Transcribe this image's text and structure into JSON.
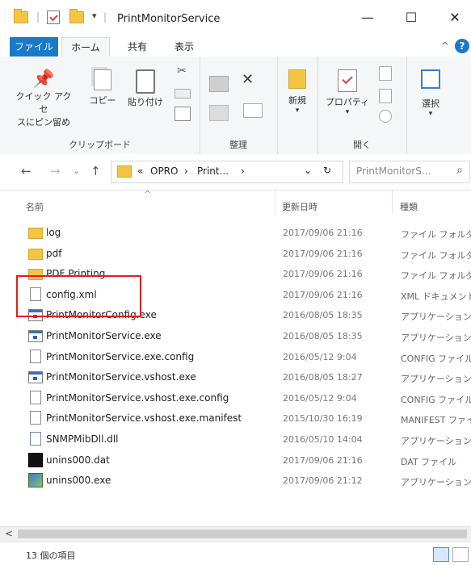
{
  "window": {
    "title": "PrintMonitorService",
    "controls": [
      "minimize-icon",
      "maximize-icon",
      "close-icon"
    ],
    "minimize_glyph": "—",
    "maximize_glyph": "☐",
    "close_glyph": "✕"
  },
  "ribbon_tabs": [
    "ファイル",
    "ホーム",
    "共有",
    "表示"
  ],
  "help_glyph": "?",
  "collapse_glyph": "^",
  "ribbon": {
    "clipboard": {
      "label": "クリップボード",
      "quick_access_line1": "クイック アクセ",
      "quick_access_line2": "スにピン留め",
      "copy": "コピー",
      "paste": "貼り付け"
    },
    "organize": {
      "label": "整理"
    },
    "open": {
      "label": "開く",
      "new": "新規",
      "properties": "プロパティ"
    },
    "select": {
      "label": "選択"
    }
  },
  "address": {
    "back": "←",
    "forward": "→",
    "down": "⌄",
    "up": "↑",
    "prefix": "«",
    "crumbs": [
      "OPRO",
      "Print..."
    ],
    "separator": "›",
    "dropdown": "⌄",
    "refresh": "↻",
    "search_placeholder": "PrintMonitorS...",
    "search_glyph": "⌕"
  },
  "columns": {
    "name": "名前",
    "date": "更新日時",
    "type": "種類",
    "sort_glyph": "^"
  },
  "files": [
    {
      "name": "log",
      "date": "2017/09/06 21:16",
      "type": "ファイル フォルダー",
      "icon": "folder-icon"
    },
    {
      "name": "pdf",
      "date": "2017/09/06 21:16",
      "type": "ファイル フォルダー",
      "icon": "folder-icon"
    },
    {
      "name": "PDF Printing",
      "date": "2017/09/06 21:16",
      "type": "ファイル フォルダー",
      "icon": "folder-icon"
    },
    {
      "name": "config.xml",
      "date": "2017/09/06 21:16",
      "type": "XML ドキュメント",
      "icon": "document-icon"
    },
    {
      "name": "PrintMonitorConfig.exe",
      "date": "2016/08/05 18:35",
      "type": "アプリケーション",
      "icon": "exe-icon"
    },
    {
      "name": "PrintMonitorService.exe",
      "date": "2016/08/05 18:35",
      "type": "アプリケーション",
      "icon": "exe-icon"
    },
    {
      "name": "PrintMonitorService.exe.config",
      "date": "2016/05/12 9:04",
      "type": "CONFIG ファイル",
      "icon": "document-icon"
    },
    {
      "name": "PrintMonitorService.vshost.exe",
      "date": "2016/08/05 18:27",
      "type": "アプリケーション",
      "icon": "exe-icon"
    },
    {
      "name": "PrintMonitorService.vshost.exe.config",
      "date": "2016/05/12 9:04",
      "type": "CONFIG ファイル",
      "icon": "document-icon"
    },
    {
      "name": "PrintMonitorService.vshost.exe.manifest",
      "date": "2015/10/30 16:19",
      "type": "MANIFEST ファイル",
      "icon": "document-icon"
    },
    {
      "name": "SNMPMibDll.dll",
      "date": "2016/05/10 14:04",
      "type": "アプリケーション拡張",
      "icon": "dll-icon"
    },
    {
      "name": "unins000.dat",
      "date": "2017/09/06 21:16",
      "type": "DAT ファイル",
      "icon": "dat-icon"
    },
    {
      "name": "unins000.exe",
      "date": "2017/09/06 21:12",
      "type": "アプリケーション",
      "icon": "setup-exe-icon"
    }
  ],
  "hscroll_left": "<",
  "status": {
    "count": "13 個の項目"
  },
  "colors": {
    "accent": "#1979ca",
    "highlight": "#e21d1d",
    "folder": "#f4c542"
  }
}
